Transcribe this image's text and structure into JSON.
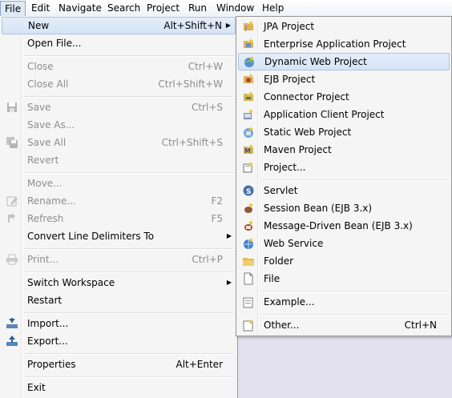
{
  "menubar": {
    "items": [
      "File",
      "Edit",
      "Navigate",
      "Search",
      "Project",
      "Run",
      "Window",
      "Help"
    ]
  },
  "file_menu": {
    "new": {
      "label": "New",
      "accel": "Alt+Shift+N"
    },
    "open_file": {
      "label": "Open File..."
    },
    "close": {
      "label": "Close",
      "accel": "Ctrl+W"
    },
    "close_all": {
      "label": "Close All",
      "accel": "Ctrl+Shift+W"
    },
    "save": {
      "label": "Save",
      "accel": "Ctrl+S"
    },
    "save_as": {
      "label": "Save As..."
    },
    "save_all": {
      "label": "Save All",
      "accel": "Ctrl+Shift+S"
    },
    "revert": {
      "label": "Revert"
    },
    "move": {
      "label": "Move..."
    },
    "rename": {
      "label": "Rename...",
      "accel": "F2"
    },
    "refresh": {
      "label": "Refresh",
      "accel": "F5"
    },
    "convert": {
      "label": "Convert Line Delimiters To"
    },
    "print": {
      "label": "Print...",
      "accel": "Ctrl+P"
    },
    "switch_workspace": {
      "label": "Switch Workspace"
    },
    "restart": {
      "label": "Restart"
    },
    "import": {
      "label": "Import..."
    },
    "export": {
      "label": "Export..."
    },
    "properties": {
      "label": "Properties",
      "accel": "Alt+Enter"
    },
    "exit": {
      "label": "Exit"
    }
  },
  "new_submenu": {
    "jpa_project": "JPA Project",
    "enterprise_app": "Enterprise Application Project",
    "dynamic_web": "Dynamic Web Project",
    "ejb_project": "EJB Project",
    "connector": "Connector Project",
    "app_client": "Application Client Project",
    "static_web": "Static Web Project",
    "maven": "Maven Project",
    "project": "Project...",
    "servlet": "Servlet",
    "session_bean": "Session Bean (EJB 3.x)",
    "mdb": "Message-Driven Bean (EJB 3.x)",
    "web_service": "Web Service",
    "folder": "Folder",
    "file": "File",
    "example": "Example...",
    "other": {
      "label": "Other...",
      "accel": "Ctrl+N"
    }
  },
  "colors": {
    "highlight": "#d6e4f5",
    "disabled_text": "#8d8d8d",
    "menu_bg": "#f5f5f5"
  }
}
